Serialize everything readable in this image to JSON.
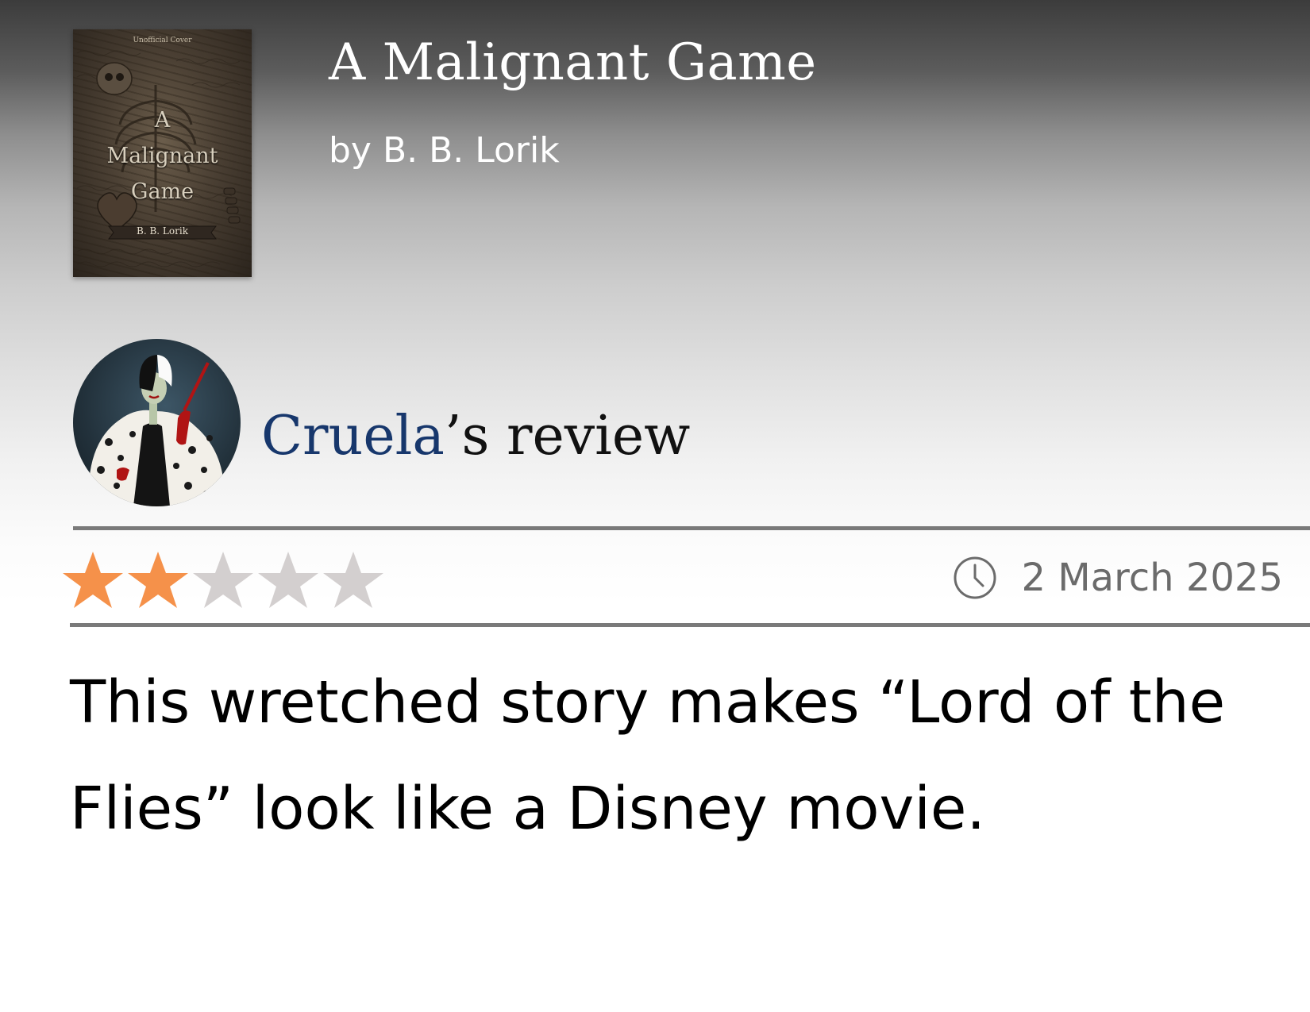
{
  "book": {
    "title": "A Malignant Game",
    "author_line": "by B. B. Lorik",
    "cover": {
      "tag": "Unofficial Cover",
      "title_line1": "A",
      "title_line2": "Malignant",
      "title_line3": "Game",
      "author": "B. B. Lorik"
    }
  },
  "review": {
    "reviewer_name": "Cruela",
    "heading_suffix": "’s review",
    "rating": 2,
    "max_rating": 5,
    "date": "2 March 2025",
    "text": "This wretched story makes “Lord of the Flies” look like a Disney movie."
  },
  "icons": {
    "clock": "clock-icon",
    "star_filled": "star-filled-icon",
    "star_empty": "star-empty-icon"
  },
  "colors": {
    "reviewer_link": "#17376c",
    "star_filled": "#f5914a",
    "star_empty": "#d3cfcf",
    "rule": "#7a7a7a",
    "date_text": "#6b6b6b"
  }
}
